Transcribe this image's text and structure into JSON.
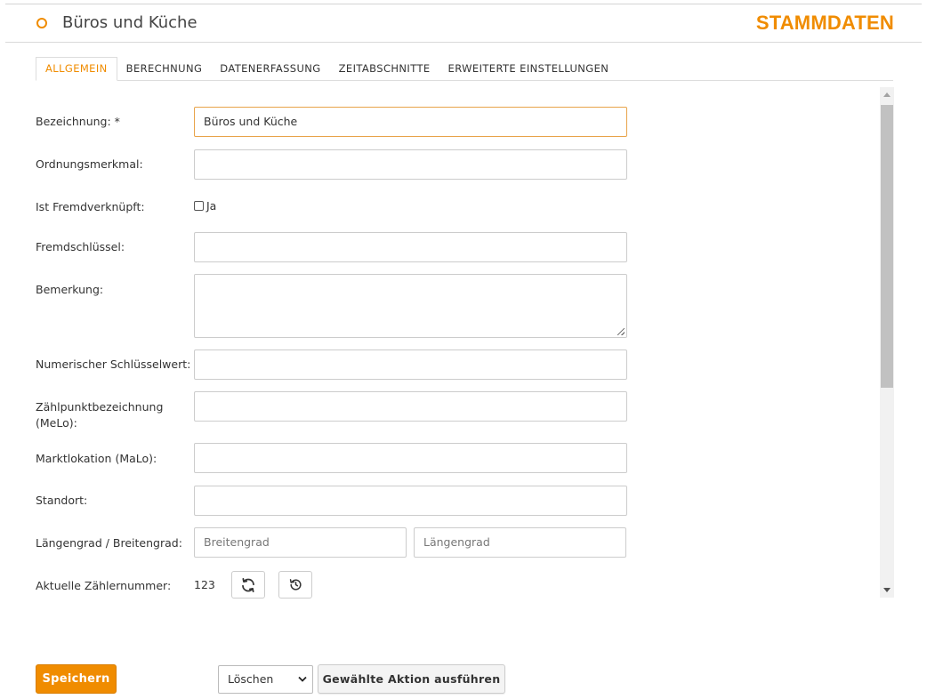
{
  "header": {
    "title": "Büros und Küche",
    "section": "STAMMDATEN",
    "accent_color": "#f08c00",
    "status_icon": "circle-icon"
  },
  "tabs": [
    {
      "label": "ALLGEMEIN",
      "active": true
    },
    {
      "label": "BERECHNUNG",
      "active": false
    },
    {
      "label": "DATENERFASSUNG",
      "active": false
    },
    {
      "label": "ZEITABSCHNITTE",
      "active": false
    },
    {
      "label": "ERWEITERTE EINSTELLUNGEN",
      "active": false
    }
  ],
  "form": {
    "bezeichnung": {
      "label": "Bezeichnung: *",
      "value": "Büros und Küche"
    },
    "ordnungsmerkmal": {
      "label": "Ordnungsmerkmal:",
      "value": ""
    },
    "fremdverknuepft": {
      "label": "Ist Fremdverknüpft:",
      "checkbox_label": "Ja",
      "checked": false
    },
    "fremdschluessel": {
      "label": "Fremdschlüssel:",
      "value": ""
    },
    "bemerkung": {
      "label": "Bemerkung:",
      "value": ""
    },
    "numerischer_schluesselwert": {
      "label": "Numerischer Schlüsselwert:",
      "value": ""
    },
    "zaehlpunktbezeichnung": {
      "label_line1": "Zählpunktbezeichnung",
      "label_line2": "(MeLo):",
      "value": ""
    },
    "marktlokation": {
      "label": "Marktlokation (MaLo):",
      "value": ""
    },
    "standort": {
      "label": "Standort:",
      "value": ""
    },
    "geo": {
      "label": "Längengrad / Breitengrad:",
      "breitengrad_placeholder": "Breitengrad",
      "laengengrad_placeholder": "Längengrad"
    },
    "zaehlernummer": {
      "label": "Aktuelle Zählernummer:",
      "value": "123",
      "refresh_icon": "refresh-icon",
      "history_icon": "history-icon"
    }
  },
  "footer": {
    "save_label": "Speichern",
    "action_selected": "Löschen",
    "execute_label": "Gewählte Aktion ausführen"
  }
}
